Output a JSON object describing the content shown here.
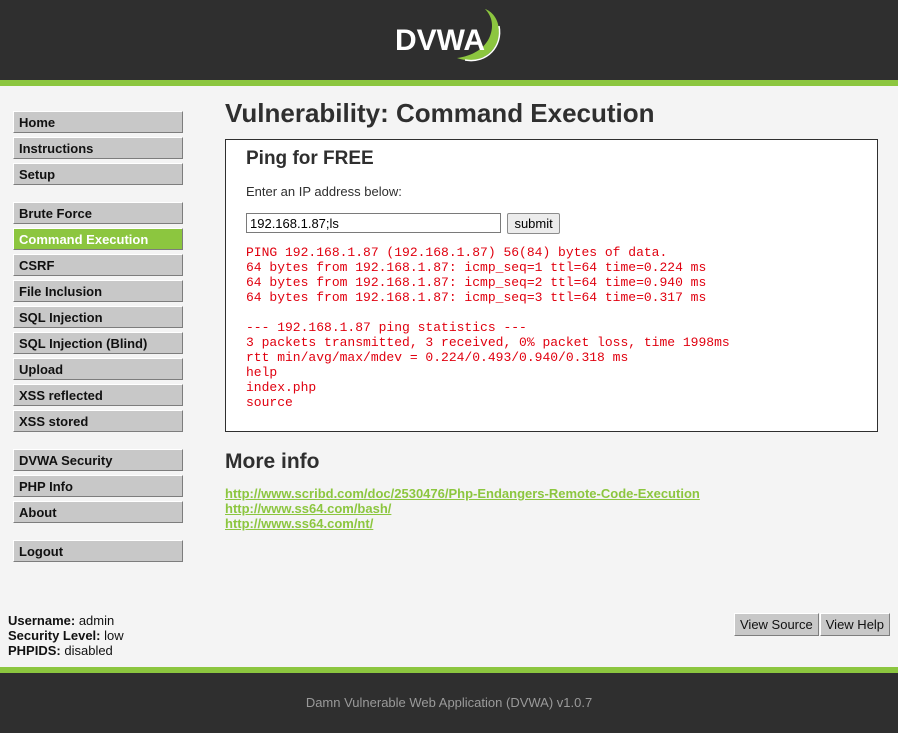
{
  "header": {
    "logo_text": "DVWA",
    "colors": {
      "bar": "#2f2f2f",
      "accent": "#8cc63f"
    }
  },
  "menu": {
    "groups": [
      {
        "items": [
          "Home",
          "Instructions",
          "Setup"
        ]
      },
      {
        "items": [
          "Brute Force",
          "Command Execution",
          "CSRF",
          "File Inclusion",
          "SQL Injection",
          "SQL Injection (Blind)",
          "Upload",
          "XSS reflected",
          "XSS stored"
        ]
      },
      {
        "items": [
          "DVWA Security",
          "PHP Info",
          "About"
        ]
      },
      {
        "items": [
          "Logout"
        ]
      }
    ],
    "selected": "Command Execution"
  },
  "main": {
    "title": "Vulnerability: Command Execution",
    "box": {
      "title": "Ping for FREE",
      "prompt": "Enter an IP address below:",
      "input_value": "192.168.1.87;ls",
      "submit_label": "submit",
      "output": "PING 192.168.1.87 (192.168.1.87) 56(84) bytes of data.\n64 bytes from 192.168.1.87: icmp_seq=1 ttl=64 time=0.224 ms\n64 bytes from 192.168.1.87: icmp_seq=2 ttl=64 time=0.940 ms\n64 bytes from 192.168.1.87: icmp_seq=3 ttl=64 time=0.317 ms\n\n--- 192.168.1.87 ping statistics ---\n3 packets transmitted, 3 received, 0% packet loss, time 1998ms\nrtt min/avg/max/mdev = 0.224/0.493/0.940/0.318 ms\nhelp\nindex.php\nsource"
    },
    "more_info": {
      "title": "More info",
      "links": [
        "http://www.scribd.com/doc/2530476/Php-Endangers-Remote-Code-Execution",
        "http://www.ss64.com/bash/",
        "http://www.ss64.com/nt/"
      ]
    }
  },
  "user_info": {
    "username_label": "Username:",
    "username": "admin",
    "security_label": "Security Level:",
    "security": "low",
    "phpids_label": "PHPIDS:",
    "phpids": "disabled"
  },
  "buttons": {
    "view_source": "View Source",
    "view_help": "View Help"
  },
  "footer": {
    "text": "Damn Vulnerable Web Application (DVWA) v1.0.7"
  }
}
